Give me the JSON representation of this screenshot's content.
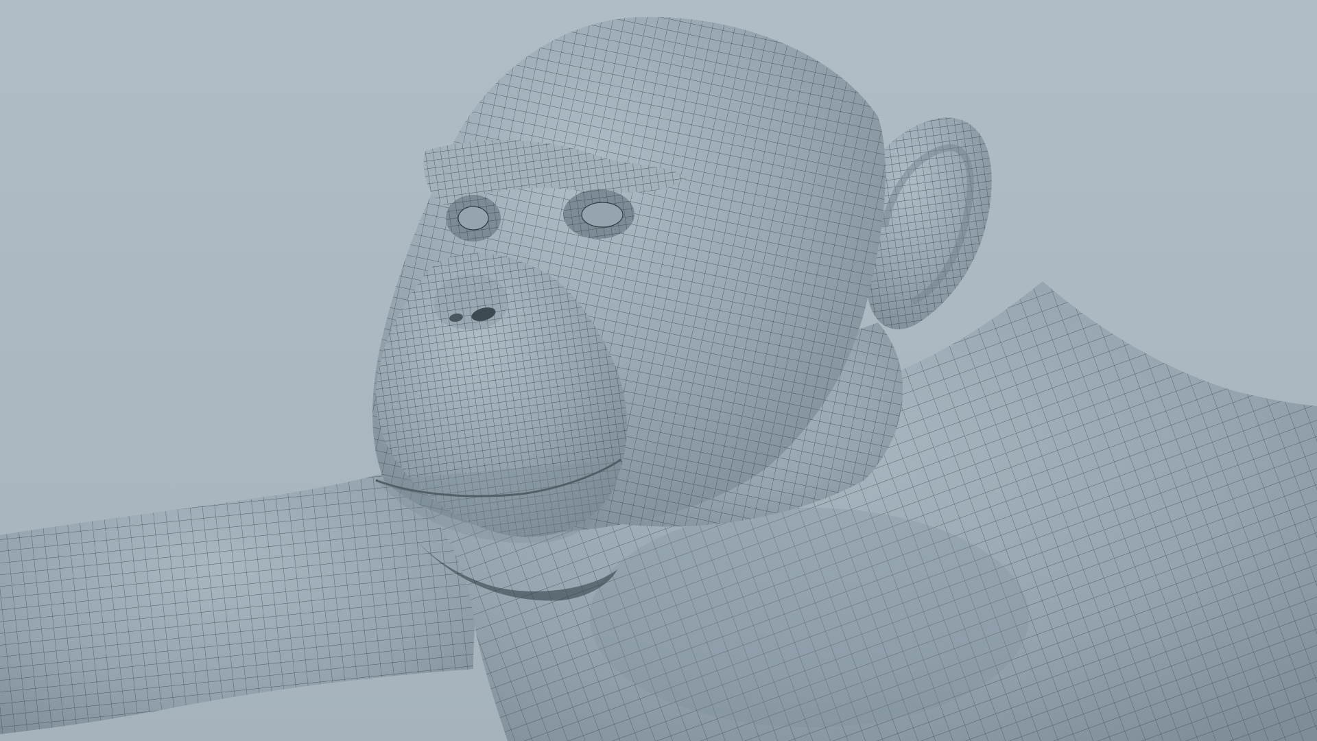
{
  "scene": {
    "subject": "chimpanzee-wireframe-model",
    "colors": {
      "background": "#a9b6c0",
      "background_light": "#b5c1ca",
      "surface": "#95a4af",
      "surface_light": "#a7b5bf",
      "surface_shadow": "#7c8b96",
      "wire": "#2e3a42"
    }
  }
}
